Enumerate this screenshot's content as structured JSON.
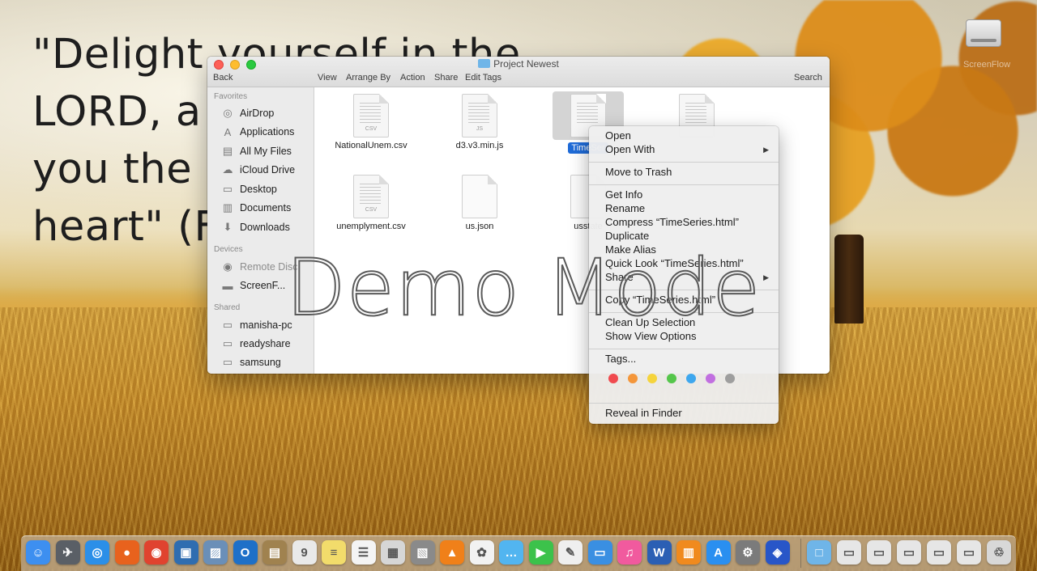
{
  "desktop": {
    "verse": "\"Delight yourself in the\nLORD, a\nyou the\nheart\" (F",
    "drive_label": "ScreenFlow"
  },
  "finder": {
    "title": "Project Newest",
    "toolbar": {
      "back": "Back",
      "view": "View",
      "arrange": "Arrange By",
      "action": "Action",
      "share": "Share",
      "edit_tags": "Edit Tags",
      "search": "Search"
    },
    "sidebar": {
      "favorites_header": "Favorites",
      "favorites": [
        {
          "label": "AirDrop",
          "icon": "airdrop-icon"
        },
        {
          "label": "Applications",
          "icon": "applications-icon"
        },
        {
          "label": "All My Files",
          "icon": "all-files-icon"
        },
        {
          "label": "iCloud Drive",
          "icon": "cloud-icon"
        },
        {
          "label": "Desktop",
          "icon": "desktop-icon"
        },
        {
          "label": "Documents",
          "icon": "documents-icon"
        },
        {
          "label": "Downloads",
          "icon": "downloads-icon"
        }
      ],
      "devices_header": "Devices",
      "devices": [
        {
          "label": "Remote Disc",
          "icon": "disc-icon"
        },
        {
          "label": "ScreenF...",
          "icon": "drive-icon"
        }
      ],
      "shared_header": "Shared",
      "shared": [
        {
          "label": "manisha-pc",
          "icon": "computer-icon"
        },
        {
          "label": "readyshare",
          "icon": "computer-icon"
        },
        {
          "label": "samsung",
          "icon": "computer-icon"
        }
      ]
    },
    "files": [
      {
        "name": "NationalUnem.csv",
        "tag": "CSV"
      },
      {
        "name": "d3.v3.min.js",
        "tag": "JS"
      },
      {
        "name": "TimeSer",
        "tag": ""
      },
      {
        "name": "",
        "tag": ""
      },
      {
        "name": "unemplyment.csv",
        "tag": "CSV"
      },
      {
        "name": "us.json",
        "tag": ""
      },
      {
        "name": "usstate",
        "tag": ""
      }
    ]
  },
  "context_menu": {
    "items": {
      "open": "Open",
      "open_with": "Open With",
      "move_to_trash": "Move to Trash",
      "get_info": "Get Info",
      "rename": "Rename",
      "compress": "Compress “TimeSeries.html”",
      "duplicate": "Duplicate",
      "make_alias": "Make Alias",
      "quick_look": "Quick Look “TimeSeries.html”",
      "share": "Share",
      "copy": "Copy “TimeSeries.html”",
      "clean_up": "Clean Up Selection",
      "show_view_options": "Show View Options",
      "tags": "Tags...",
      "reveal": "Reveal in Finder"
    },
    "tag_colors": [
      "#f04a4f",
      "#f4963a",
      "#f5d43c",
      "#55c64b",
      "#3ea7ee",
      "#c16fe0",
      "#9e9e9e"
    ]
  },
  "watermark": "Demo Mode",
  "dock": {
    "apps": [
      {
        "name": "finder-icon",
        "glyph": "☺",
        "color": "#3d8ff0"
      },
      {
        "name": "launchpad-icon",
        "glyph": "✈",
        "color": "#5a5f66"
      },
      {
        "name": "safari-icon",
        "glyph": "◎",
        "color": "#2b8fe8"
      },
      {
        "name": "firefox-icon",
        "glyph": "●",
        "color": "#e8621d"
      },
      {
        "name": "chrome-icon",
        "glyph": "◉",
        "color": "#e0432f"
      },
      {
        "name": "remote-desktop-icon",
        "glyph": "▣",
        "color": "#2f6db0"
      },
      {
        "name": "preview-icon",
        "glyph": "▨",
        "color": "#6a8fb8"
      },
      {
        "name": "outlook-icon",
        "glyph": "O",
        "color": "#1e70c8"
      },
      {
        "name": "contacts-icon",
        "glyph": "▤",
        "color": "#a0824f"
      },
      {
        "name": "calendar-icon",
        "glyph": "9",
        "color": "#e9e9e9"
      },
      {
        "name": "notes-icon",
        "glyph": "≡",
        "color": "#f2dc6b"
      },
      {
        "name": "reminders-icon",
        "glyph": "☰",
        "color": "#f4f4f4"
      },
      {
        "name": "photo-booth-icon",
        "glyph": "▦",
        "color": "#d6d6d6"
      },
      {
        "name": "stickies-icon",
        "glyph": "▧",
        "color": "#8a8a8a"
      },
      {
        "name": "vlc-icon",
        "glyph": "▲",
        "color": "#f08019"
      },
      {
        "name": "photos-icon",
        "glyph": "✿",
        "color": "#f2f2f2"
      },
      {
        "name": "messages-icon",
        "glyph": "…",
        "color": "#52b5f0"
      },
      {
        "name": "facetime-icon",
        "glyph": "▶",
        "color": "#3cc24b"
      },
      {
        "name": "textedit-icon",
        "glyph": "✎",
        "color": "#efefef"
      },
      {
        "name": "keynote-icon",
        "glyph": "▭",
        "color": "#3a8fe2"
      },
      {
        "name": "itunes-icon",
        "glyph": "♫",
        "color": "#f15a9e"
      },
      {
        "name": "word-icon",
        "glyph": "W",
        "color": "#2b5fb4"
      },
      {
        "name": "ibooks-icon",
        "glyph": "▥",
        "color": "#f08a1e"
      },
      {
        "name": "app-store-icon",
        "glyph": "A",
        "color": "#2a8ff0"
      },
      {
        "name": "system-preferences-icon",
        "glyph": "⚙",
        "color": "#7b7b7b"
      },
      {
        "name": "screenflow-icon",
        "glyph": "◈",
        "color": "#2856c8"
      }
    ],
    "right": [
      {
        "name": "folder-icon",
        "glyph": "□",
        "color": "#6fb5e8"
      },
      {
        "name": "screenshot-icon",
        "glyph": "▭",
        "color": "#e6e6e6"
      },
      {
        "name": "screenshot-icon",
        "glyph": "▭",
        "color": "#e6e6e6"
      },
      {
        "name": "screenshot-icon",
        "glyph": "▭",
        "color": "#e6e6e6"
      },
      {
        "name": "screenshot-icon",
        "glyph": "▭",
        "color": "#e6e6e6"
      },
      {
        "name": "screenshot-icon",
        "glyph": "▭",
        "color": "#e6e6e6"
      },
      {
        "name": "trash-icon",
        "glyph": "♲",
        "color": "#d8d8d8"
      }
    ]
  }
}
